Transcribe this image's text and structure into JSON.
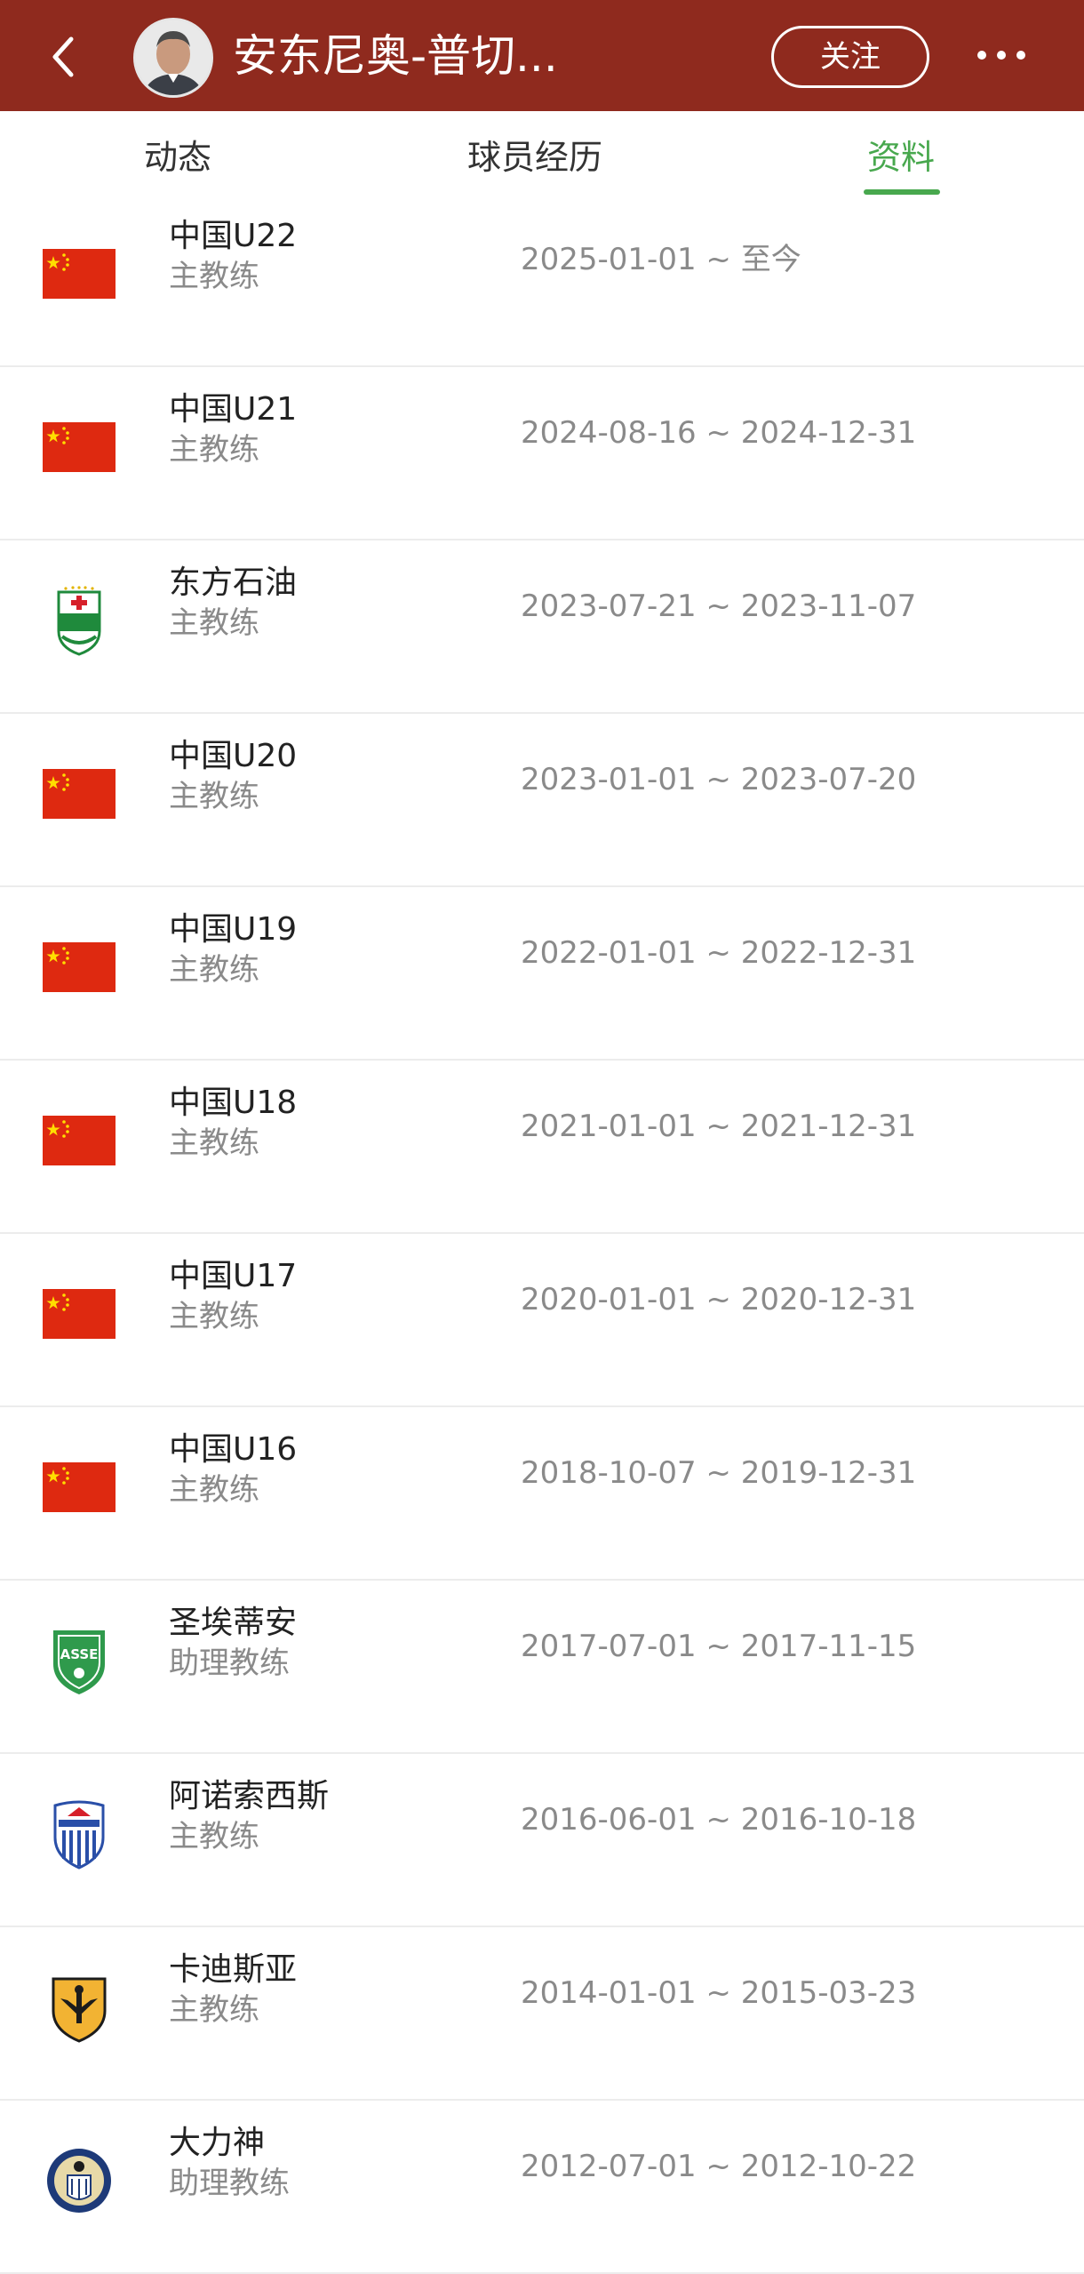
{
  "header": {
    "title": "安东尼奥-普切...",
    "follow_label": "关注",
    "background": "#8f2a1e"
  },
  "tabs": [
    {
      "label": "动态",
      "active": false
    },
    {
      "label": "球员经历",
      "active": false
    },
    {
      "label": "资料",
      "active": true
    }
  ],
  "accent_color": "#48a84e",
  "career": [
    {
      "team": "中国U22",
      "role": "主教练",
      "period": "2025-01-01 ~ 至今",
      "logo": "china-flag-icon"
    },
    {
      "team": "中国U21",
      "role": "主教练",
      "period": "2024-08-16 ~ 2024-12-31",
      "logo": "china-flag-icon"
    },
    {
      "team": "东方石油",
      "role": "主教练",
      "period": "2023-07-21 ~ 2023-11-07",
      "logo": "oriente-petrolero-crest-icon"
    },
    {
      "team": "中国U20",
      "role": "主教练",
      "period": "2023-01-01 ~ 2023-07-20",
      "logo": "china-flag-icon"
    },
    {
      "team": "中国U19",
      "role": "主教练",
      "period": "2022-01-01 ~ 2022-12-31",
      "logo": "china-flag-icon"
    },
    {
      "team": "中国U18",
      "role": "主教练",
      "period": "2021-01-01 ~ 2021-12-31",
      "logo": "china-flag-icon"
    },
    {
      "team": "中国U17",
      "role": "主教练",
      "period": "2020-01-01 ~ 2020-12-31",
      "logo": "china-flag-icon"
    },
    {
      "team": "中国U16",
      "role": "主教练",
      "period": "2018-10-07 ~ 2019-12-31",
      "logo": "china-flag-icon"
    },
    {
      "team": "圣埃蒂安",
      "role": "助理教练",
      "period": "2017-07-01 ~ 2017-11-15",
      "logo": "asse-crest-icon"
    },
    {
      "team": "阿诺索西斯",
      "role": "主教练",
      "period": "2016-06-01 ~ 2016-10-18",
      "logo": "anorthosis-crest-icon"
    },
    {
      "team": "卡迪斯亚",
      "role": "主教练",
      "period": "2014-01-01 ~ 2015-03-23",
      "logo": "qadsia-crest-icon"
    },
    {
      "team": "大力神",
      "role": "助理教练",
      "period": "2012-07-01 ~ 2012-10-22",
      "logo": "hercules-crest-icon"
    }
  ]
}
